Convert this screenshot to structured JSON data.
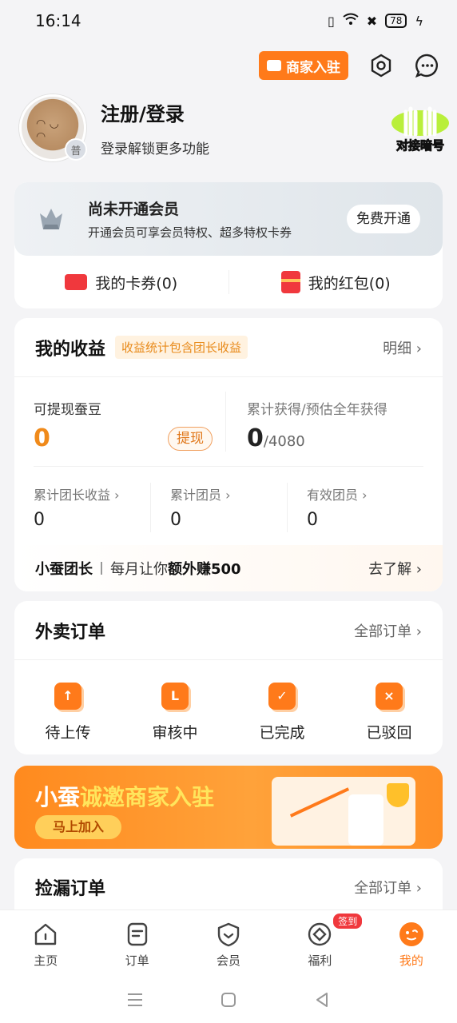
{
  "status_bar": {
    "time": "16:14",
    "battery": "78"
  },
  "top_actions": {
    "merchant_label": "商家入驻"
  },
  "profile": {
    "title": "注册/登录",
    "subtitle": "登录解锁更多功能",
    "level_badge": "普"
  },
  "mascot": {
    "text": "对接暗号"
  },
  "member": {
    "title": "尚未开通会员",
    "desc": "开通会员可享会员特权、超多特权卡券",
    "button": "免费开通"
  },
  "coupons": [
    {
      "label": "我的卡券(0)",
      "icon": "ticket-icon"
    },
    {
      "label": "我的红包(0)",
      "icon": "red-envelope-icon"
    }
  ],
  "earnings": {
    "title": "我的收益",
    "tag": "收益统计包含团长收益",
    "detail_link": "明细 ›",
    "withdrawable_label": "可提现蚕豆",
    "withdrawable_value": "0",
    "withdraw_button": "提现",
    "cumulative_label": "累计获得/预估全年获得",
    "cumulative_value": "0",
    "cumulative_total": "/4080",
    "stats": [
      {
        "label": "累计团长收益 ›",
        "value": "0"
      },
      {
        "label": "累计团员 ›",
        "value": "0"
      },
      {
        "label": "有效团员 ›",
        "value": "0"
      }
    ],
    "leader": {
      "logo": "小蚕团长",
      "text": "每月让你",
      "bold": "额外赚500",
      "link": "去了解 ›"
    }
  },
  "takeout_orders": {
    "title": "外卖订单",
    "all_link": "全部订单 ›",
    "statuses": [
      {
        "label": "待上传",
        "glyph": "↑",
        "icon": "upload-icon"
      },
      {
        "label": "审核中",
        "glyph": "L",
        "icon": "reviewing-icon"
      },
      {
        "label": "已完成",
        "glyph": "✓",
        "icon": "check-icon"
      },
      {
        "label": "已驳回",
        "glyph": "×",
        "icon": "reject-icon"
      }
    ]
  },
  "promo": {
    "title_white": "小蚕",
    "title_yellow": "诚邀商家入驻",
    "button": "马上加入"
  },
  "missed_orders": {
    "title": "捡漏订单",
    "all_link": "全部订单 ›"
  },
  "tabbar": [
    {
      "label": "主页",
      "icon": "home-icon"
    },
    {
      "label": "订单",
      "icon": "orders-icon"
    },
    {
      "label": "会员",
      "icon": "member-icon"
    },
    {
      "label": "福利",
      "icon": "welfare-icon",
      "badge": "签到"
    },
    {
      "label": "我的",
      "icon": "mine-icon",
      "active": true
    }
  ],
  "colors": {
    "accent": "#ff7a1a",
    "red": "#f0383d",
    "background": "#f4f4f6"
  }
}
